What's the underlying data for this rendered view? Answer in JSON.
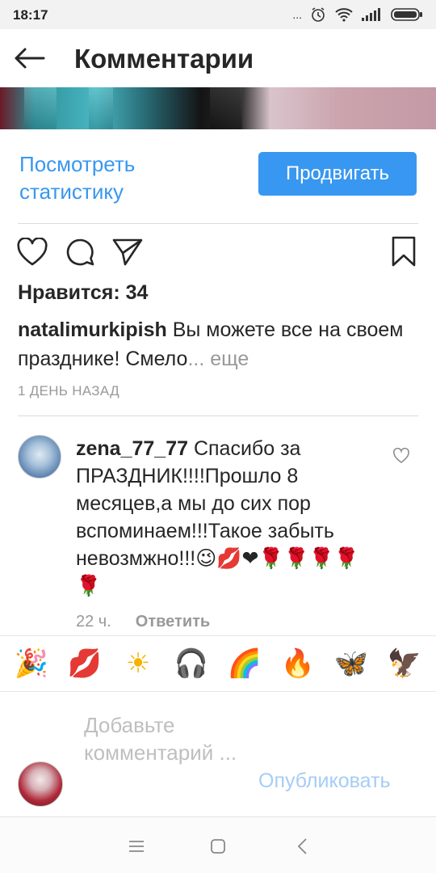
{
  "status_bar": {
    "time": "18:17",
    "dots": "..."
  },
  "header": {
    "title": "Комментарии"
  },
  "post": {
    "view_stats_label": "Посмотреть статистику",
    "promote_label": "Продвигать",
    "likes": "Нравится: 34",
    "caption_user": "natalimurkipish",
    "caption_text": "Вы можете все на своем празднике! Смело",
    "caption_more": "... еще",
    "time": "1 ДЕНЬ НАЗАД"
  },
  "comment": {
    "user": "zena_77_77",
    "text": "Спасибо за ПРАЗДНИК!!!!Прошло 8 месяцев,а мы до сих пор вспоминаем!!!Такое забыть невозмжно!!!😉💋❤🌹🌹🌹🌹🌹",
    "time": "22 ч.",
    "reply_label": "Ответить"
  },
  "emoji_bar": [
    "🎉",
    "💋",
    "☀",
    "🎧",
    "🌈",
    "🔥",
    "🦋",
    "🦅"
  ],
  "composer": {
    "placeholder": "Добавьте комментарий ...",
    "publish_label": "Опубликовать"
  },
  "colors": {
    "accent": "#3897f0",
    "muted": "#999999",
    "publish_disabled": "#a5cdf5"
  }
}
